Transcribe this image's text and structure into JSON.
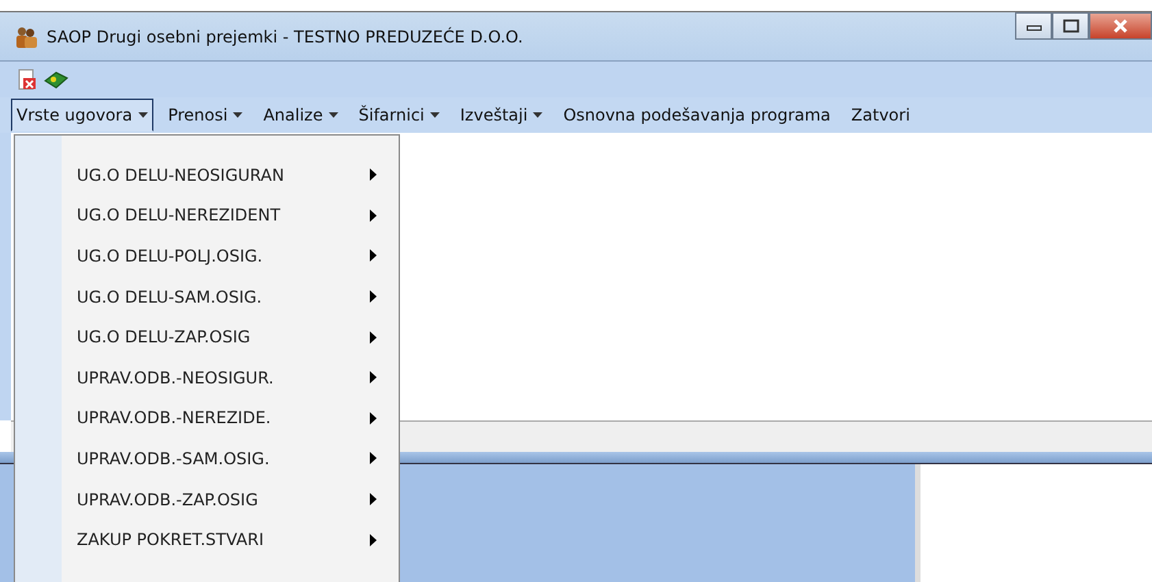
{
  "window": {
    "title": "SAOP Drugi osebni prejemki - TESTNO PREDUZEĆE D.O.O."
  },
  "menu_bar": [
    {
      "label": "Vrste ugovora",
      "has_dropdown": true,
      "selected": true
    },
    {
      "label": "Prenosi",
      "has_dropdown": true,
      "selected": false
    },
    {
      "label": "Analize",
      "has_dropdown": true,
      "selected": false
    },
    {
      "label": "Šifarnici",
      "has_dropdown": true,
      "selected": false
    },
    {
      "label": "Izveštaji",
      "has_dropdown": true,
      "selected": false
    },
    {
      "label": "Osnovna podešavanja programa",
      "has_dropdown": false,
      "selected": false
    },
    {
      "label": "Zatvori",
      "has_dropdown": false,
      "selected": false
    }
  ],
  "dropdown": [
    {
      "label": "UG.O DELU-NEOSIGURAN",
      "has_submenu": true
    },
    {
      "label": "UG.O DELU-NEREZIDENT",
      "has_submenu": true
    },
    {
      "label": "UG.O DELU-POLJ.OSIG.",
      "has_submenu": true
    },
    {
      "label": "UG.O DELU-SAM.OSIG.",
      "has_submenu": true
    },
    {
      "label": "UG.O DELU-ZAP.OSIG",
      "has_submenu": true
    },
    {
      "label": "UPRAV.ODB.-NEOSIGUR.",
      "has_submenu": true
    },
    {
      "label": "UPRAV.ODB.-NEREZIDE.",
      "has_submenu": true
    },
    {
      "label": "UPRAV.ODB.-SAM.OSIG.",
      "has_submenu": true
    },
    {
      "label": "UPRAV.ODB.-ZAP.OSIG",
      "has_submenu": true
    },
    {
      "label": "ZAKUP POKRET.STVARI",
      "has_submenu": true
    }
  ]
}
